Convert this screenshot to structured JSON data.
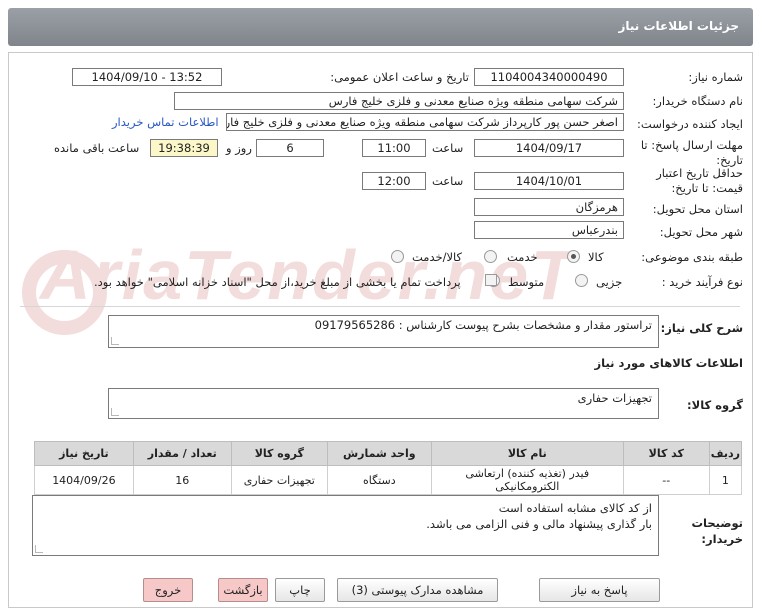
{
  "header": {
    "title": "جزئیات اطلاعات نیاز"
  },
  "watermark": "AriaTender.neT",
  "fields": {
    "need_number_label": "شماره نیاز:",
    "need_number": "1104004340000490",
    "announce_label": "تاریخ و ساعت اعلان عمومی:",
    "announce_value": "1404/09/10 - 13:52",
    "buyer_label": "نام دستگاه خریدار:",
    "buyer_value": "شرکت سهامی منطقه ویژه صنایع معدنی و فلزی خلیج فارس",
    "requester_label": "ایجاد کننده درخواست:",
    "requester_value": "اصغر حسن پور کارپرداز شرکت سهامی منطقه ویژه صنایع معدنی و فلزی خلیج فارس",
    "contact_link": "اطلاعات تماس خریدار",
    "deadline_label": "مهلت ارسال پاسخ: تا تاریخ:",
    "deadline_date": "1404/09/17",
    "time_label": "ساعت",
    "deadline_time": "11:00",
    "days_value": "6",
    "days_label": "روز و",
    "remaining_time": "19:38:39",
    "remaining_label": "ساعت باقی مانده",
    "validity_label": "حداقل تاریخ اعتبار قیمت: تا تاریخ:",
    "validity_date": "1404/10/01",
    "validity_time": "12:00",
    "province_label": "استان محل تحویل:",
    "province_value": "هرمزگان",
    "city_label": "شهر محل تحویل:",
    "city_value": "بندرعباس",
    "category_label": "طبقه بندی موضوعی:",
    "category_options": [
      "کالا",
      "خدمت",
      "کالا/خدمت"
    ],
    "category_selected": "کالا",
    "process_label": "نوع فرآیند خرید :",
    "process_options": [
      "جزیی",
      "متوسط"
    ],
    "process_selected": "متوسط",
    "payment_note": "پرداخت تمام یا بخشی از مبلغ خرید،از محل \"اسناد خزانه اسلامی\" خواهد بود.",
    "description_label": "شرح کلی نیاز:",
    "description_value": "تراستور مقدار و مشخصات بشرح پیوست کارشناس : 09179565286",
    "goods_info_title": "اطلاعات کالاهای مورد نیاز",
    "goods_group_label": "گروه کالا:",
    "goods_group_value": "تجهیزات حفاری",
    "buyer_notes_label": "توضیحات خریدار:",
    "buyer_notes_line1": "از کد کالای مشابه استفاده است",
    "buyer_notes_line2": "بار گذاری پیشنهاد مالی و فنی الزامی می باشد."
  },
  "table": {
    "headers": [
      "ردیف",
      "کد کالا",
      "نام کالا",
      "واحد شمارش",
      "گروه کالا",
      "تعداد / مقدار",
      "تاریخ نیاز"
    ],
    "rows": [
      [
        "1",
        "--",
        "فیدر (تغذیه کننده) ارتعاشی الکترومکانیکی",
        "دستگاه",
        "تجهیزات حفاری",
        "16",
        "1404/09/26"
      ]
    ]
  },
  "buttons": {
    "reply": "پاسخ به نیاز",
    "attachments": "مشاهده مدارک پیوستی (3)",
    "print": "چاپ",
    "back": "بازگشت",
    "exit": "خروج"
  }
}
